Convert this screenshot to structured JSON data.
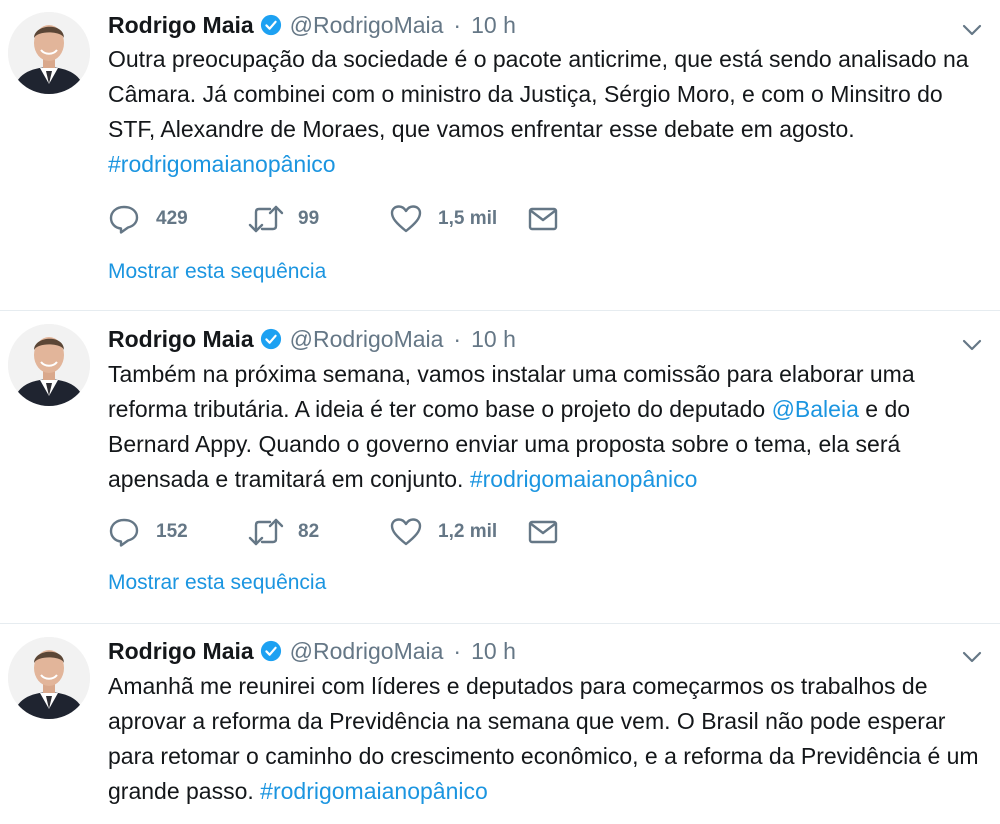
{
  "colors": {
    "link": "#1b95e0",
    "muted": "#657786",
    "text": "#14171a",
    "verified": "#1da1f2"
  },
  "icons": {
    "verified": "verified-badge-icon",
    "caret": "chevron-down-icon",
    "reply": "reply-icon",
    "retweet": "retweet-icon",
    "like": "heart-icon",
    "dm": "envelope-icon"
  },
  "tweets": [
    {
      "name": "Rodrigo Maia",
      "handle": "@RodrigoMaia",
      "separator": "·",
      "time": "10 h",
      "text_before": "Outra preocupação da sociedade é o pacote anticrime, que está sendo analisado na Câmara. Já combinei com o ministro da Justiça, Sérgio Moro, e com o Minsitro do STF, Alexandre de Moraes, que vamos enfrentar esse debate em agosto. ",
      "hashtag": "#rodrigomaianopânico",
      "replies": "429",
      "retweets": "99",
      "likes": "1,5 mil",
      "thread_link": "Mostrar esta sequência"
    },
    {
      "name": "Rodrigo Maia",
      "handle": "@RodrigoMaia",
      "separator": "·",
      "time": "10 h",
      "text_before": "Também na próxima semana, vamos instalar uma comissão para elaborar uma reforma tributária. A ideia é ter como base o projeto do deputado ",
      "mention": "@Baleia",
      "text_after": " e do Bernard Appy. Quando o governo enviar uma proposta sobre o tema, ela será apensada e tramitará em conjunto. ",
      "hashtag": "#rodrigomaianopânico",
      "replies": "152",
      "retweets": "82",
      "likes": "1,2 mil",
      "thread_link": "Mostrar esta sequência"
    },
    {
      "name": "Rodrigo Maia",
      "handle": "@RodrigoMaia",
      "separator": "·",
      "time": "10 h",
      "text_before": "Amanhã me reunirei com líderes e deputados para começarmos os trabalhos de aprovar a reforma da Previdência na semana que vem. O Brasil não pode esperar para retomar o caminho do crescimento econômico, e a reforma da Previdência é um grande passo. ",
      "hashtag": "#rodrigomaianopânico"
    }
  ]
}
